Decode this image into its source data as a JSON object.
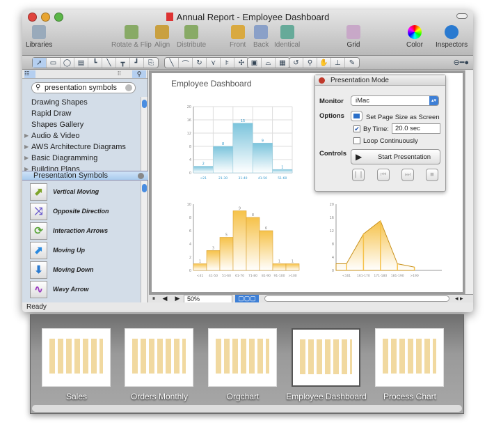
{
  "window": {
    "title": "Annual Report - Employee Dashboard"
  },
  "toolbar": {
    "items": [
      {
        "label": "Libraries"
      },
      {
        "label": "Rotate & Flip"
      },
      {
        "label": "Align"
      },
      {
        "label": "Distribute"
      },
      {
        "label": "Front"
      },
      {
        "label": "Back"
      },
      {
        "label": "Identical"
      },
      {
        "label": "Grid"
      },
      {
        "label": "Color"
      },
      {
        "label": "Inspectors"
      }
    ]
  },
  "sidebar": {
    "search_value": "presentation symbols",
    "libraries": [
      {
        "label": "Drawing Shapes",
        "expandable": false
      },
      {
        "label": "Rapid Draw",
        "expandable": false
      },
      {
        "label": "Shapes Gallery",
        "expandable": false
      },
      {
        "label": "Audio & Video",
        "expandable": true
      },
      {
        "label": "AWS Architecture Diagrams",
        "expandable": true
      },
      {
        "label": "Basic Diagramming",
        "expandable": true
      },
      {
        "label": "Building Plans",
        "expandable": true
      }
    ],
    "section_title": "Presentation Symbols",
    "symbols": [
      {
        "label": "Vertical Moving",
        "glyph": "⬈",
        "color": "#7ea42a"
      },
      {
        "label": "Opposite Direction",
        "glyph": "⤨",
        "color": "#6a5acd"
      },
      {
        "label": "Interaction Arrows",
        "glyph": "⟳",
        "color": "#5aa53a"
      },
      {
        "label": "Moving Up",
        "glyph": "⬈",
        "color": "#2a8ae0"
      },
      {
        "label": "Moving Down",
        "glyph": "⬇",
        "color": "#2a7ad0"
      },
      {
        "label": "Wavy Arrow",
        "glyph": "∿",
        "color": "#9a3ac0"
      }
    ]
  },
  "canvas": {
    "title": "Employee Dashboard",
    "zoom": "50%"
  },
  "status": "Ready",
  "presentation": {
    "title": "Presentation Mode",
    "monitor_label": "Monitor",
    "monitor_value": "iMac",
    "options_label": "Options",
    "page_size_label": "Set Page Size as Screen",
    "by_time_label": "By Time:",
    "by_time_checked": true,
    "by_time_value": "20.0 sec",
    "loop_label": "Loop Continuously",
    "loop_checked": false,
    "controls_label": "Controls",
    "start_label": "Start Presentation"
  },
  "chart_data": [
    {
      "type": "bar",
      "categories": [
        "<21",
        "21-30",
        "31-40",
        "41-50",
        "51-60"
      ],
      "values": [
        2,
        8,
        15,
        9,
        1
      ],
      "ylim": [
        0,
        20
      ],
      "yticks": [
        0,
        4,
        8,
        12,
        16,
        20
      ],
      "grid": true,
      "color": "#7cc4dc"
    },
    {
      "type": "bar",
      "categories": [
        "<41",
        "41-50",
        "51-60",
        "61-70",
        "71-80",
        "81-90",
        "91-100",
        ">100"
      ],
      "values": [
        1,
        3,
        5,
        9,
        8,
        6,
        1,
        1
      ],
      "ylim": [
        0,
        10
      ],
      "yticks": [
        0,
        2,
        4,
        6,
        8,
        10
      ],
      "grid": false,
      "color": "#f6c24a"
    },
    {
      "type": "area",
      "categories": [
        "<161",
        "161-170",
        "171-180",
        "181-190",
        ">190"
      ],
      "values": [
        2,
        11,
        15,
        2,
        1
      ],
      "ylim": [
        0,
        20
      ],
      "yticks": [
        0,
        4,
        8,
        12,
        16,
        20
      ],
      "grid": false,
      "color": "#f6c24a"
    }
  ],
  "bottom": {
    "thumbnails": [
      {
        "label": "Sales"
      },
      {
        "label": "Orders Monthly"
      },
      {
        "label": "Orgchart"
      },
      {
        "label": "Employee Dashboard",
        "current": true
      },
      {
        "label": "Process Chart"
      }
    ]
  }
}
